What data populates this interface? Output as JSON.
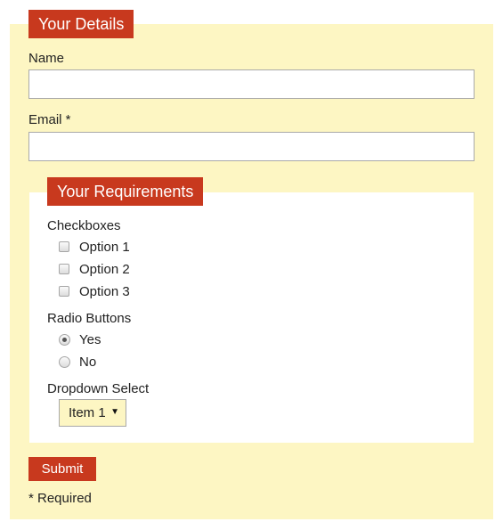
{
  "details": {
    "legend": "Your Details",
    "name_label": "Name",
    "name_value": "",
    "email_label": "Email *",
    "email_value": ""
  },
  "requirements": {
    "legend": "Your Requirements",
    "checkbox_group_label": "Checkboxes",
    "checkboxes": [
      {
        "label": "Option 1",
        "checked": false
      },
      {
        "label": "Option 2",
        "checked": false
      },
      {
        "label": "Option 3",
        "checked": false
      }
    ],
    "radio_group_label": "Radio Buttons",
    "radios": [
      {
        "label": "Yes",
        "checked": true
      },
      {
        "label": "No",
        "checked": false
      }
    ],
    "dropdown_label": "Dropdown Select",
    "dropdown_selected": "Item 1",
    "dropdown_arrow": "▼"
  },
  "submit_label": "Submit",
  "required_note": "* Required",
  "colors": {
    "accent": "#c8391e",
    "panel_background": "#fdf6c3",
    "inner_background": "#ffffff"
  }
}
